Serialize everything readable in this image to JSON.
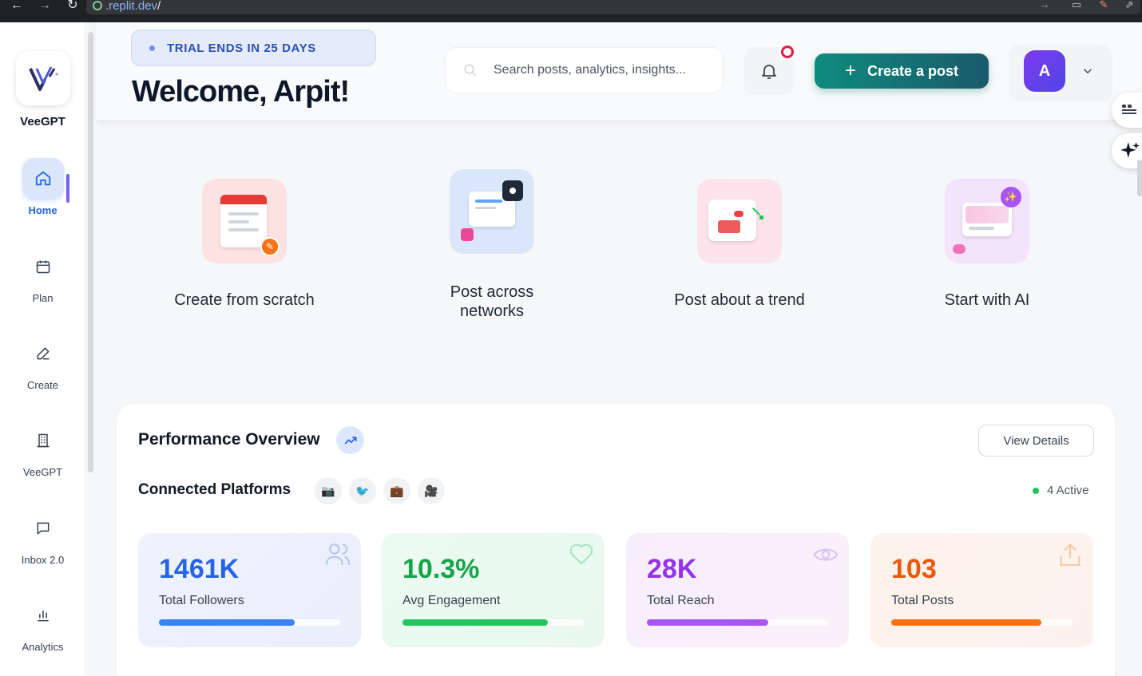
{
  "browser": {
    "url_host": ".replit.dev",
    "url_path": "/"
  },
  "sidebar": {
    "logo_text": "VeeGPT",
    "items": [
      {
        "label": "Home",
        "icon": "home-icon",
        "active": true
      },
      {
        "label": "Plan",
        "icon": "calendar-icon",
        "active": false
      },
      {
        "label": "Create",
        "icon": "pen-icon",
        "active": false
      },
      {
        "label": "VeeGPT",
        "icon": "building-icon",
        "active": false
      },
      {
        "label": "Inbox 2.0",
        "icon": "chat-icon",
        "active": false
      },
      {
        "label": "Analytics",
        "icon": "bar-chart-icon",
        "active": false
      }
    ]
  },
  "header": {
    "trial_text": "TRIAL ENDS IN 25 DAYS",
    "welcome": "Welcome, Arpit!",
    "search_placeholder": "Search posts, analytics, insights...",
    "create_label": "Create a post",
    "avatar_initial": "A"
  },
  "quick_actions": [
    {
      "line1": "Create from scratch",
      "line2": ""
    },
    {
      "line1": "Post across",
      "line2": "networks"
    },
    {
      "line1": "Post about a trend",
      "line2": ""
    },
    {
      "line1": "Start with AI",
      "line2": ""
    }
  ],
  "performance": {
    "title": "Performance Overview",
    "view_details": "View Details",
    "connected_title": "Connected Platforms",
    "platform_icons": [
      "camera-icon",
      "bird-icon",
      "briefcase-icon",
      "video-camera-icon"
    ],
    "active_count": "4 Active",
    "stats": [
      {
        "value": "1461K",
        "label": "Total Followers",
        "progress": 0.75,
        "color": "#2563eb",
        "bar": "#3b82f6",
        "icon": "users-icon"
      },
      {
        "value": "10.3%",
        "label": "Avg Engagement",
        "progress": 0.8,
        "color": "#16a34a",
        "bar": "#22c55e",
        "icon": "heart-icon"
      },
      {
        "value": "28K",
        "label": "Total Reach",
        "progress": 0.67,
        "color": "#9333ea",
        "bar": "#a855f7",
        "icon": "eye-icon"
      },
      {
        "value": "103",
        "label": "Total Posts",
        "progress": 0.83,
        "color": "#ea580c",
        "bar": "#f97316",
        "icon": "share-icon"
      }
    ]
  },
  "colors": {
    "accent": "#2563eb",
    "primary_button": "#0f8b7e",
    "notification_badge": "#e11d48"
  }
}
